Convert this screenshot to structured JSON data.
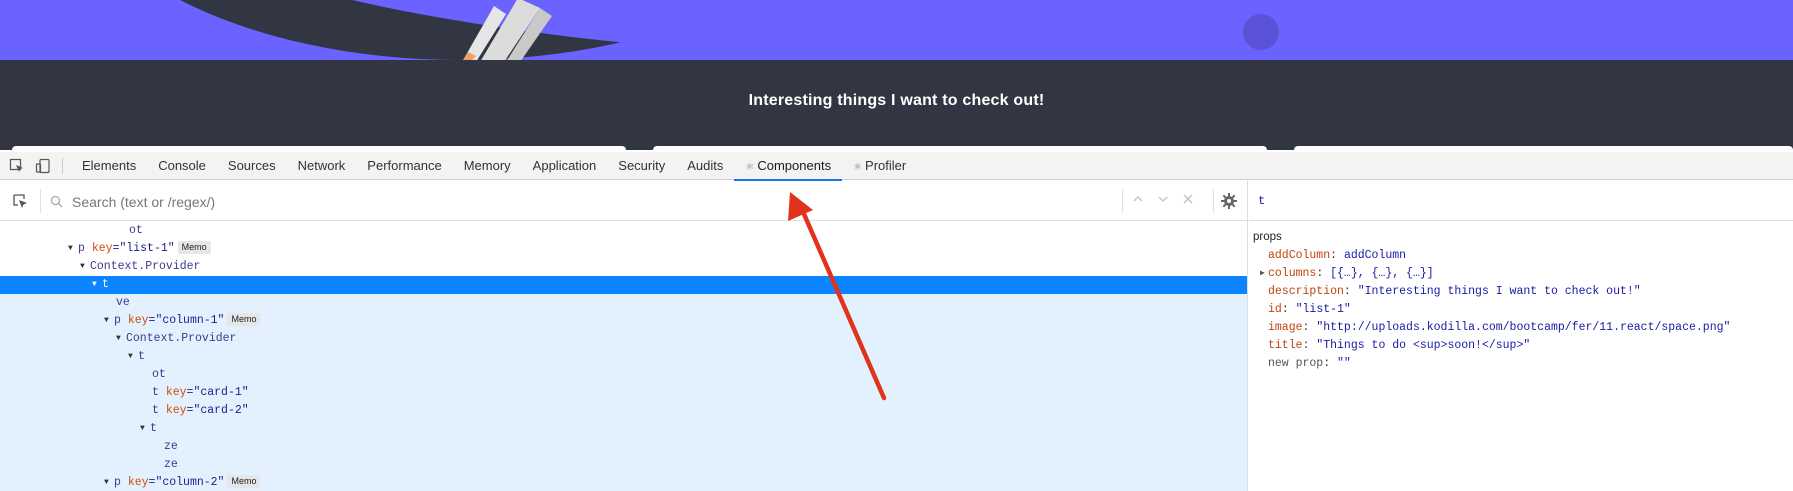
{
  "page": {
    "heading": "Interesting things I want to check out!"
  },
  "devtools": {
    "tabs": [
      {
        "label": "Elements"
      },
      {
        "label": "Console"
      },
      {
        "label": "Sources"
      },
      {
        "label": "Network"
      },
      {
        "label": "Performance"
      },
      {
        "label": "Memory"
      },
      {
        "label": "Application"
      },
      {
        "label": "Security"
      },
      {
        "label": "Audits"
      },
      {
        "label": "Components",
        "active": true
      },
      {
        "label": "Profiler"
      }
    ],
    "search": {
      "placeholder": "Search (text or /regex/)",
      "value": ""
    },
    "tree": [
      {
        "name": "ot"
      },
      {
        "name": "p",
        "key_attr": "key",
        "key_val": "\"list-1\"",
        "badge": "Memo"
      },
      {
        "name": "Context.Provider"
      },
      {
        "name": "t",
        "selected": true
      },
      {
        "name": "ve"
      },
      {
        "name": "p",
        "key_attr": "key",
        "key_val": "\"column-1\"",
        "badge": "Memo"
      },
      {
        "name": "Context.Provider"
      },
      {
        "name": "t"
      },
      {
        "name": "ot"
      },
      {
        "name": "t",
        "key_attr": "key",
        "key_val": "\"card-1\""
      },
      {
        "name": "t",
        "key_attr": "key",
        "key_val": "\"card-2\""
      },
      {
        "name": "t"
      },
      {
        "name": "ze"
      },
      {
        "name": "ze"
      },
      {
        "name": "p",
        "key_attr": "key",
        "key_val": "\"column-2\"",
        "badge": "Memo"
      }
    ],
    "selected_component": "t",
    "props_title": "props",
    "props": [
      {
        "key": "addColumn",
        "value": "addColumn"
      },
      {
        "key": "columns",
        "value": "[{…}, {…}, {…}]",
        "expandable": true
      },
      {
        "key": "description",
        "value": "\"Interesting things I want to check out!\""
      },
      {
        "key": "id",
        "value": "\"list-1\""
      },
      {
        "key": "image",
        "value": "\"http://uploads.kodilla.com/bootcamp/fer/11.react/space.png\""
      },
      {
        "key": "title",
        "value": "\"Things to do <sup>soon!</sup>\""
      },
      {
        "key": "new prop",
        "value": "\"\"",
        "plain": true
      }
    ]
  },
  "colors": {
    "hero": "#6b63ff",
    "page_bg": "#313642",
    "selected_row": "#0a84ff",
    "subtree_bg": "#e3f0fd",
    "annotation_arrow": "#e0321c"
  }
}
